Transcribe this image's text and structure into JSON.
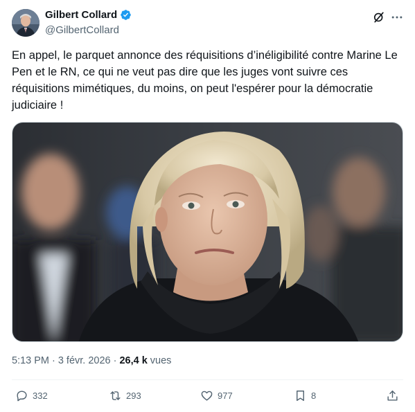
{
  "author": {
    "display_name": "Gilbert Collard",
    "handle": "@GilbertCollard",
    "verified": true
  },
  "tweet": {
    "text": "En appel, le parquet annonce des réquisitions d’inéligibilité contre Marine Le Pen et le RN, ce qui ne veut pas dire que les juges vont suivre ces réquisitions mimétiques, du moins, on peut l'espérer pour la démocratie judiciaire !"
  },
  "meta": {
    "time": "5:13 PM",
    "separator": "·",
    "date": "3 févr. 2026",
    "separator2": "·",
    "views_count": "26,4 k",
    "views_label": "vues"
  },
  "actions": {
    "replies": "332",
    "reposts": "293",
    "likes": "977",
    "bookmarks": "8"
  },
  "icons": {
    "verified": "verified-badge-icon",
    "grok": "grok-icon",
    "more": "more-icon",
    "reply": "reply-icon",
    "repost": "repost-icon",
    "like": "heart-icon",
    "bookmark": "bookmark-icon",
    "share": "share-icon"
  },
  "colors": {
    "verified": "#1d9bf0",
    "secondary_text": "#536471",
    "primary_text": "#0f1419"
  }
}
